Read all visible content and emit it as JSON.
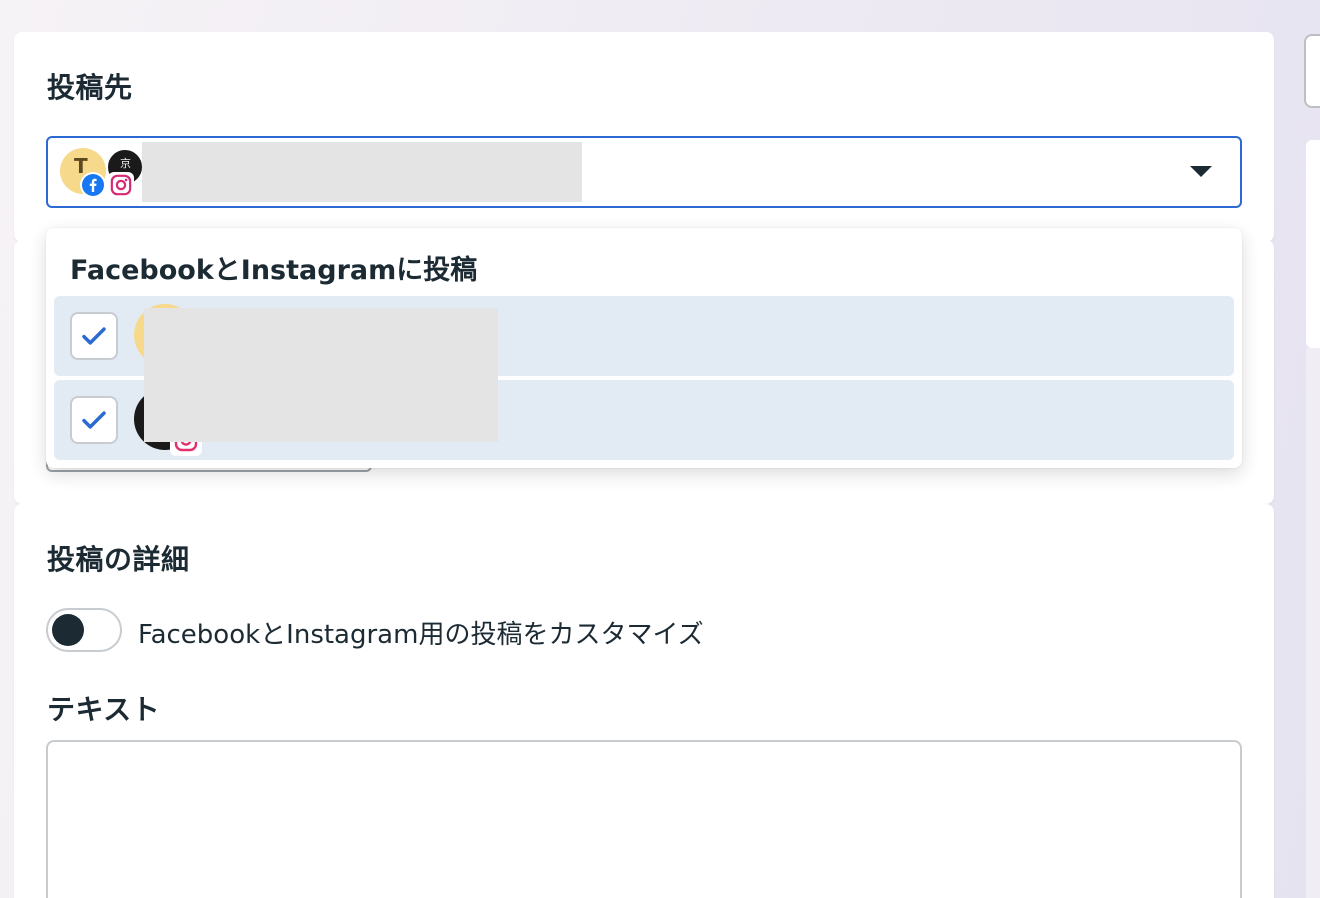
{
  "destination": {
    "title": "投稿先",
    "selector": {
      "avatar_initial": "T",
      "avatar_back_text": "京",
      "icons": [
        "facebook-icon",
        "instagram-icon"
      ],
      "expanded": true
    }
  },
  "dropdown": {
    "heading": "FacebookとInstagramに投稿",
    "options": [
      {
        "checked": true,
        "platform": "facebook"
      },
      {
        "checked": true,
        "platform": "instagram"
      }
    ]
  },
  "details": {
    "title": "投稿の詳細",
    "customize_toggle": {
      "label": "FacebookとInstagram用の投稿をカスタマイズ",
      "on": false
    },
    "text_label": "テキスト",
    "text_value": ""
  },
  "colors": {
    "accent": "#2a6ad2",
    "option_bg": "#e2eaf4",
    "text": "#1c2b33",
    "facebook": "#1877f2",
    "instagram": "#d62976"
  }
}
